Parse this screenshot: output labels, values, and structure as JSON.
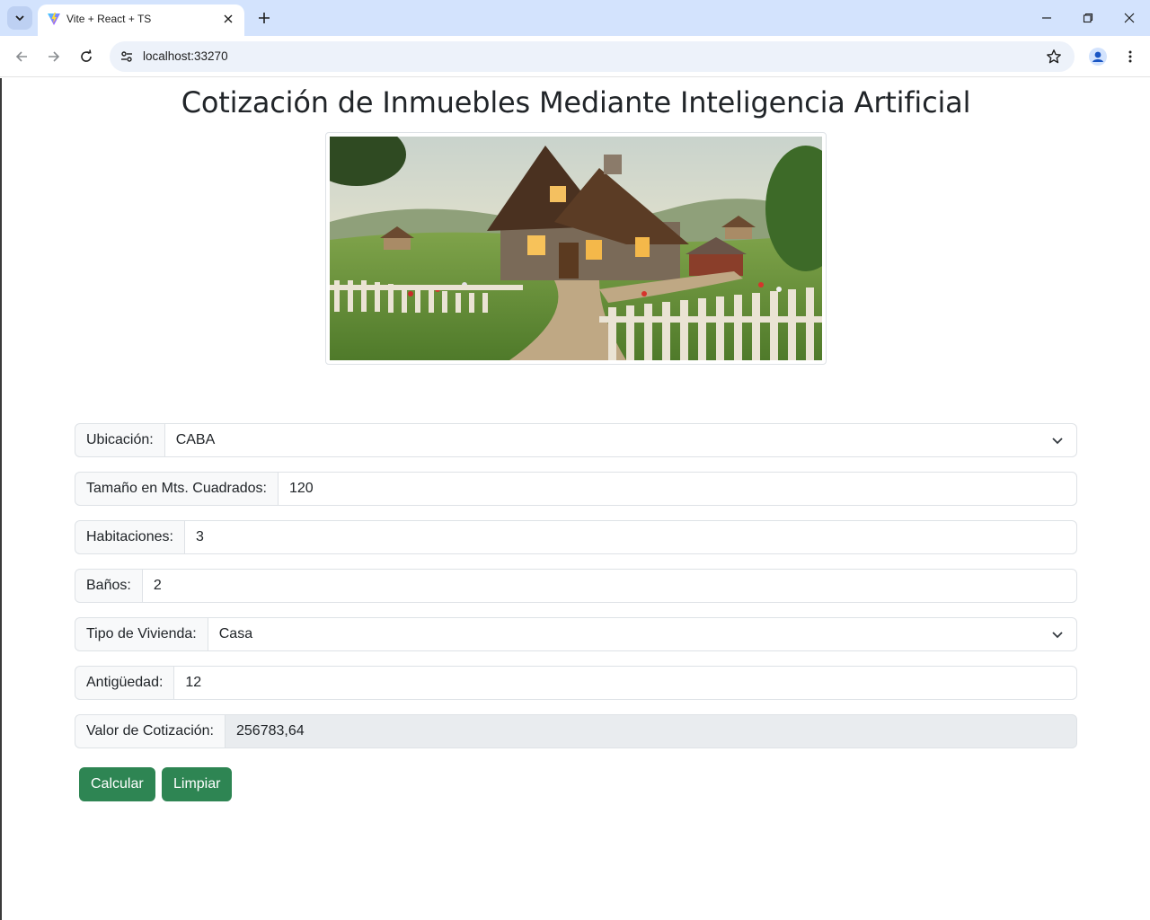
{
  "browser": {
    "tab_title": "Vite + React + TS",
    "url": "localhost:33270",
    "icons": {
      "tab_list": "chevron-down-icon",
      "favicon": "vite-logo-icon",
      "close_tab": "close-icon",
      "new_tab": "plus-icon",
      "minimize": "minimize-icon",
      "restore": "restore-icon",
      "close_window": "close-icon",
      "back": "arrow-left-icon",
      "forward": "arrow-right-icon",
      "reload": "reload-icon",
      "site_info": "tune-icon",
      "bookmark": "star-icon",
      "profile": "profile-icon",
      "menu": "kebab-menu-icon"
    }
  },
  "page": {
    "title": "Cotización de Inmuebles Mediante Inteligencia Artificial",
    "hero_image": "countryside-house-illustration"
  },
  "form": {
    "ubicacion": {
      "label": "Ubicación:",
      "value": "CABA"
    },
    "tamano": {
      "label": "Tamaño en Mts. Cuadrados:",
      "value": "120"
    },
    "habitaciones": {
      "label": "Habitaciones:",
      "value": "3"
    },
    "banos": {
      "label": "Baños:",
      "value": "2"
    },
    "tipo": {
      "label": "Tipo de Vivienda:",
      "value": "Casa"
    },
    "antiguedad": {
      "label": "Antigüedad:",
      "value": "12"
    },
    "valor": {
      "label": "Valor de Cotización:",
      "value": "256783,64"
    }
  },
  "buttons": {
    "calcular": "Calcular",
    "limpiar": "Limpiar"
  },
  "colors": {
    "primary_button": "#2e8553",
    "tabbar": "#d3e3fd",
    "omnibox": "#edf2fa",
    "readonly_field": "#e9ecef"
  }
}
